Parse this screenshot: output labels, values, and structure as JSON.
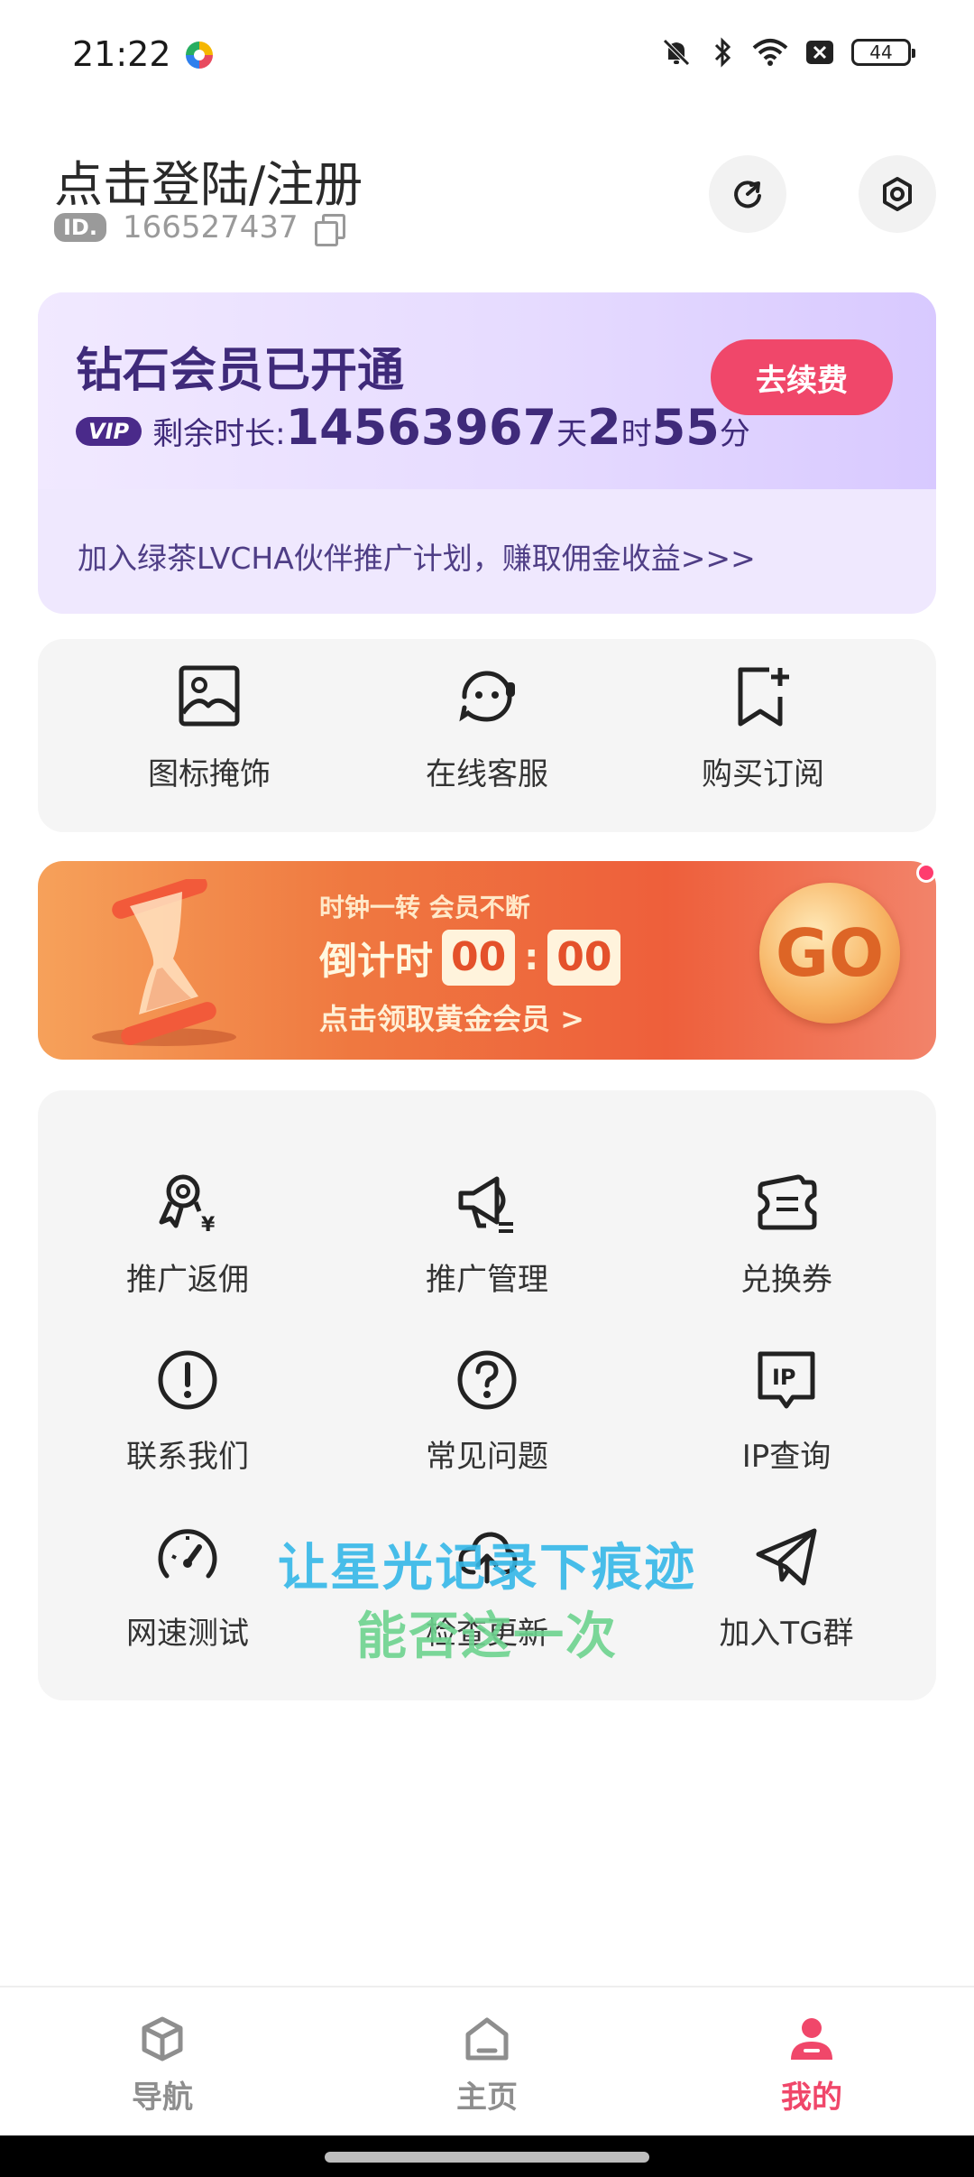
{
  "status_bar": {
    "time": "21:22",
    "battery": "44"
  },
  "header": {
    "login_title": "点击登陆/注册",
    "id_badge": "ID.",
    "user_id": "166527437"
  },
  "vip": {
    "title": "钻石会员已开通",
    "badge": "VIP",
    "remaining_label": "剩余时长:",
    "days": "14563967",
    "days_unit": "天",
    "hours": "2",
    "hours_unit": "时",
    "minutes": "55",
    "minutes_unit": "分",
    "renew_label": "去续费",
    "partner_text": "加入绿茶LVCHA伙伴推广计划，赚取佣金收益>>>"
  },
  "quick_actions": [
    {
      "label": "图标掩饰",
      "icon": "image-icon"
    },
    {
      "label": "在线客服",
      "icon": "customer-service-icon"
    },
    {
      "label": "购买订阅",
      "icon": "bookmark-add-icon"
    }
  ],
  "promo": {
    "subtitle": "时钟一转 会员不断",
    "countdown_label": "倒计时",
    "countdown_minutes": "00",
    "countdown_colon": ":",
    "countdown_seconds": "00",
    "cta": "点击领取黄金会员 >",
    "go_label": "GO"
  },
  "menu": [
    {
      "label": "推广返佣",
      "icon": "commission-icon"
    },
    {
      "label": "推广管理",
      "icon": "megaphone-icon"
    },
    {
      "label": "兑换券",
      "icon": "coupon-icon"
    },
    {
      "label": "联系我们",
      "icon": "exclamation-icon"
    },
    {
      "label": "常见问题",
      "icon": "question-icon"
    },
    {
      "label": "IP查询",
      "icon": "ip-icon"
    },
    {
      "label": "网速测试",
      "icon": "speedometer-icon"
    },
    {
      "label": "检查更新",
      "icon": "upload-icon"
    },
    {
      "label": "加入TG群",
      "icon": "telegram-icon"
    }
  ],
  "overlay": {
    "line1": "让星光记录下痕迹",
    "line2": "能否这一次"
  },
  "bottom_nav": [
    {
      "label": "导航",
      "icon": "cube-icon"
    },
    {
      "label": "主页",
      "icon": "home-icon"
    },
    {
      "label": "我的",
      "icon": "user-icon"
    }
  ],
  "colors": {
    "accent": "#f0476a",
    "vip_text": "#3f2a7a",
    "card_bg": "#f5f5f5",
    "inactive_nav": "#8e8e8e"
  }
}
